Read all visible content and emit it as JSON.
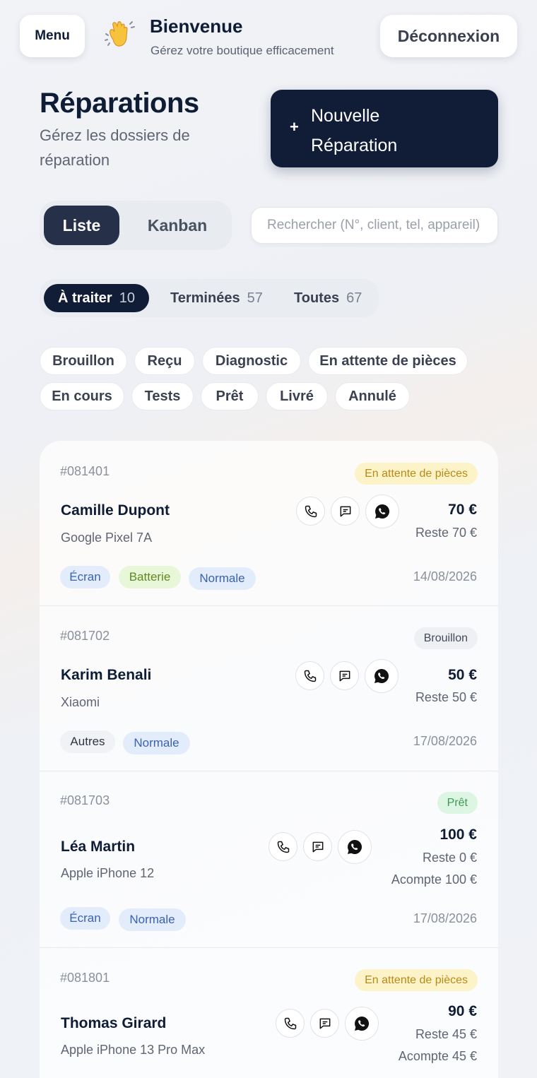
{
  "header": {
    "menu_label": "Menu",
    "welcome_title": "Bienvenue",
    "welcome_subtitle": "Gérez votre boutique efficacement",
    "logout_label": "Déconnexion"
  },
  "page": {
    "title": "Réparations",
    "subtitle": "Gérez les dossiers de réparation",
    "new_button_plus": "+",
    "new_button_label": "Nouvelle Réparation"
  },
  "view_toggle": {
    "list": "Liste",
    "kanban": "Kanban",
    "selected": "Liste"
  },
  "search": {
    "placeholder": "Rechercher (N°, client, tel, appareil)",
    "value": ""
  },
  "status_tabs": [
    {
      "label": "À traiter",
      "count": "10",
      "active": true
    },
    {
      "label": "Terminées",
      "count": "57",
      "active": false
    },
    {
      "label": "Toutes",
      "count": "67",
      "active": false
    }
  ],
  "filters": [
    "Brouillon",
    "Reçu",
    "Diagnostic",
    "En attente de pièces",
    "En cours",
    "Tests",
    "Prêt",
    "Livré",
    "Annulé"
  ],
  "repairs": [
    {
      "ref": "#081401",
      "status": "En attente de pièces",
      "name": "Camille Dupont",
      "device": "Google Pixel 7A",
      "price": "70 €",
      "rest": "Reste 70 €",
      "deposit": "",
      "tags": [
        "Écran",
        "Batterie",
        "Normale"
      ],
      "date": "14/08/2026"
    },
    {
      "ref": "#081702",
      "status": "Brouillon",
      "name": "Karim Benali",
      "device": "Xiaomi",
      "price": "50 €",
      "rest": "Reste 50 €",
      "deposit": "",
      "tags": [
        "Autres",
        "Normale"
      ],
      "date": "17/08/2026"
    },
    {
      "ref": "#081703",
      "status": "Prêt",
      "name": "Léa Martin",
      "device": "Apple iPhone 12",
      "price": "100 €",
      "rest": "Reste 0 €",
      "deposit": "Acompte 100 €",
      "tags": [
        "Écran",
        "Normale"
      ],
      "date": "17/08/2026"
    },
    {
      "ref": "#081801",
      "status": "En attente de pièces",
      "name": "Thomas Girard",
      "device": "Apple iPhone 13 Pro Max",
      "price": "90 €",
      "rest": "Reste 45 €",
      "deposit": "Acompte 45 €",
      "tags": [],
      "date": ""
    }
  ],
  "icons": {
    "call": "phone-icon",
    "sms": "message-icon",
    "whatsapp": "whatsapp-icon",
    "wave": "waving-hand-icon"
  },
  "colors": {
    "primary": "#111c37",
    "waiting": "#fdf3c9",
    "ready": "#ddf5e3",
    "tag_blue": "#e3ecfb",
    "tag_green": "#e9f7d9"
  }
}
